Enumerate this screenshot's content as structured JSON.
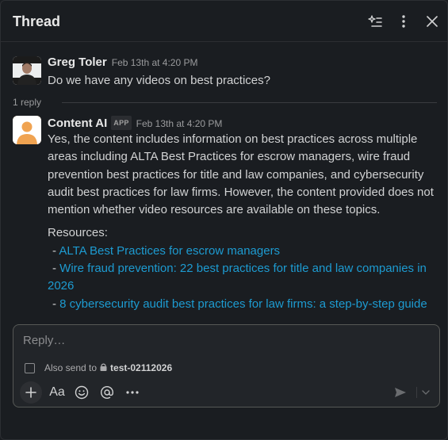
{
  "header": {
    "title": "Thread",
    "icons": [
      "sparkle-list-icon",
      "more-vertical-icon",
      "close-icon"
    ]
  },
  "message1": {
    "author": "Greg Toler",
    "timestamp": "Feb 13th at 4:20 PM",
    "text": "Do we have any videos on best practices?"
  },
  "replies": {
    "label": "1 reply"
  },
  "message2": {
    "author": "Content AI",
    "badge": "APP",
    "timestamp": "Feb 13th at 4:20 PM",
    "lines": [
      "Yes, the content includes information on best practices across multiple",
      "areas including ALTA Best Practices for escrow managers, wire fraud",
      "prevention best practices for title and law companies, and cybersecurity",
      "audit best practices for law firms. However, the content provided does not",
      "mention whether video resources are available on these topics."
    ],
    "resources_label": "Resources:",
    "bullet": "-",
    "resources": [
      {
        "lines": [
          "ALTA Best Practices for escrow managers"
        ]
      },
      {
        "lines": [
          "Wire fraud prevention: 22 best practices for title and law companies in",
          "2026"
        ]
      },
      {
        "lines": [
          "8 cybersecurity audit best practices for law firms: a step-by-step guide"
        ]
      }
    ]
  },
  "composer": {
    "placeholder": "Reply…",
    "also_send_label": "Also send to",
    "channel": "test-02112026",
    "format_label": "Aa"
  },
  "colors": {
    "background": "#1a1d21",
    "link": "#1d9bd1",
    "avatar_orange": "#f0a351"
  }
}
